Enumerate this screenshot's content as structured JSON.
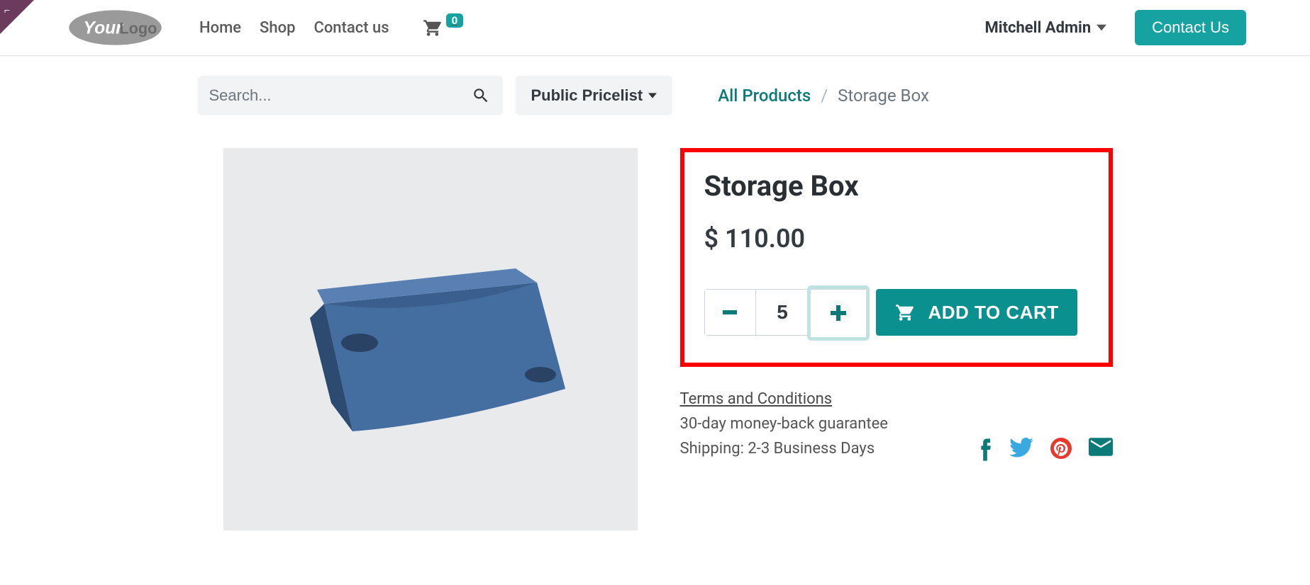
{
  "header": {
    "nav": {
      "home": "Home",
      "shop": "Shop",
      "contact": "Contact us"
    },
    "cart_count": "0",
    "user_name": "Mitchell Admin",
    "contact_button": "Contact Us"
  },
  "search": {
    "placeholder": "Search..."
  },
  "pricelist": {
    "label": "Public Pricelist"
  },
  "breadcrumb": {
    "root": "All Products",
    "separator": "/",
    "current": "Storage Box"
  },
  "product": {
    "title": "Storage Box",
    "price": "$ 110.00",
    "quantity": "5",
    "add_to_cart": "ADD TO CART"
  },
  "info": {
    "terms": "Terms and Conditions",
    "guarantee": "30-day money-back guarantee",
    "shipping": "Shipping: 2-3 Business Days"
  }
}
